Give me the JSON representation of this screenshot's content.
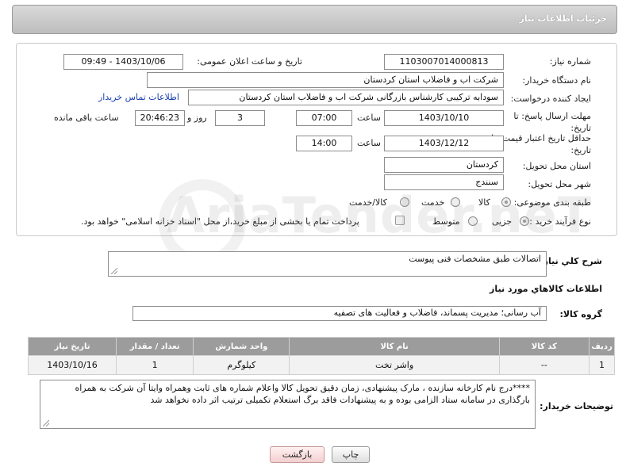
{
  "header": {
    "title": "جزئیات اطلاعات نیاز"
  },
  "form": {
    "need_number_label": "شماره نیاز:",
    "need_number": "1103007014000813",
    "announce_label": "تاریخ و ساعت اعلان عمومی:",
    "announce_value": "1403/10/06 - 09:49",
    "buyer_org_label": "نام دستگاه خریدار:",
    "buyer_org": "شرکت اب و فاضلاب استان کردستان",
    "creator_label": "ایجاد کننده درخواست:",
    "creator": "سودابه ترکیبی کارشناس بازرگانی شرکت اب و فاضلاب استان کردستان",
    "contact_link": "اطلاعات تماس خریدار",
    "deadline_label": "مهلت ارسال پاسخ: تا تاریخ:",
    "deadline_date": "1403/10/10",
    "time_label": "ساعت",
    "deadline_time": "07:00",
    "days_value": "3",
    "days_label": "روز و",
    "remaining_time": "20:46:23",
    "remaining_label": "ساعت باقی مانده",
    "validity_label": "حداقل تاریخ اعتبار قیمت: تا تاریخ:",
    "validity_date": "1403/12/12",
    "validity_time": "14:00",
    "province_label": "استان محل تحویل:",
    "province": "کردستان",
    "city_label": "شهر محل تحویل:",
    "city": "سنندج",
    "category_label": "طبقه بندی موضوعی:",
    "category_options": [
      "کالا",
      "خدمت",
      "کالا/خدمت"
    ],
    "process_label": "نوع فرآیند خرید :",
    "process_options": [
      "جزیی",
      "متوسط"
    ],
    "payment_note": "پرداخت تمام یا بخشی از مبلغ خرید،از محل \"اسناد خزانه اسلامی\" خواهد بود."
  },
  "description": {
    "label": "شرح کلي نياز:",
    "value": "اتصالات طبق مشخصات فنی پیوست"
  },
  "goods_section": {
    "title": "اطلاعات کالاهاي مورد نياز",
    "group_label": "گروه کالا:",
    "group_value": "آب رسانی؛ مدیریت پسماند، فاضلاب و فعالیت های تصفیه"
  },
  "table": {
    "headers": [
      "ردیف",
      "کد کالا",
      "نام کالا",
      "واحد شمارش",
      "تعداد / مقدار",
      "تاریخ نیاز"
    ],
    "rows": [
      [
        "1",
        "--",
        "واشر تخت",
        "کیلوگرم",
        "1",
        "1403/10/16"
      ]
    ]
  },
  "buyer_notes": {
    "label": "توضیحات خریدار:",
    "value": "****درج نام کارخانه سازنده ، مارک پیشنهادی، زمان دقیق تحویل کالا واعلام شماره های ثابت وهمراه وایتا آن شرکت به همراه بارگذاری در سامانه ستاد الزامی بوده و به پیشنهادات فاقد برگ استعلام تکمیلی ترتیب اثر داده نخواهد شد"
  },
  "buttons": {
    "print": "چاپ",
    "back": "بازگشت"
  },
  "watermark": "AriaTender.neT",
  "colors": {
    "header_bg": "#c9c9c9",
    "table_header_bg": "#9c9c9c",
    "link": "#1a3fb0"
  }
}
